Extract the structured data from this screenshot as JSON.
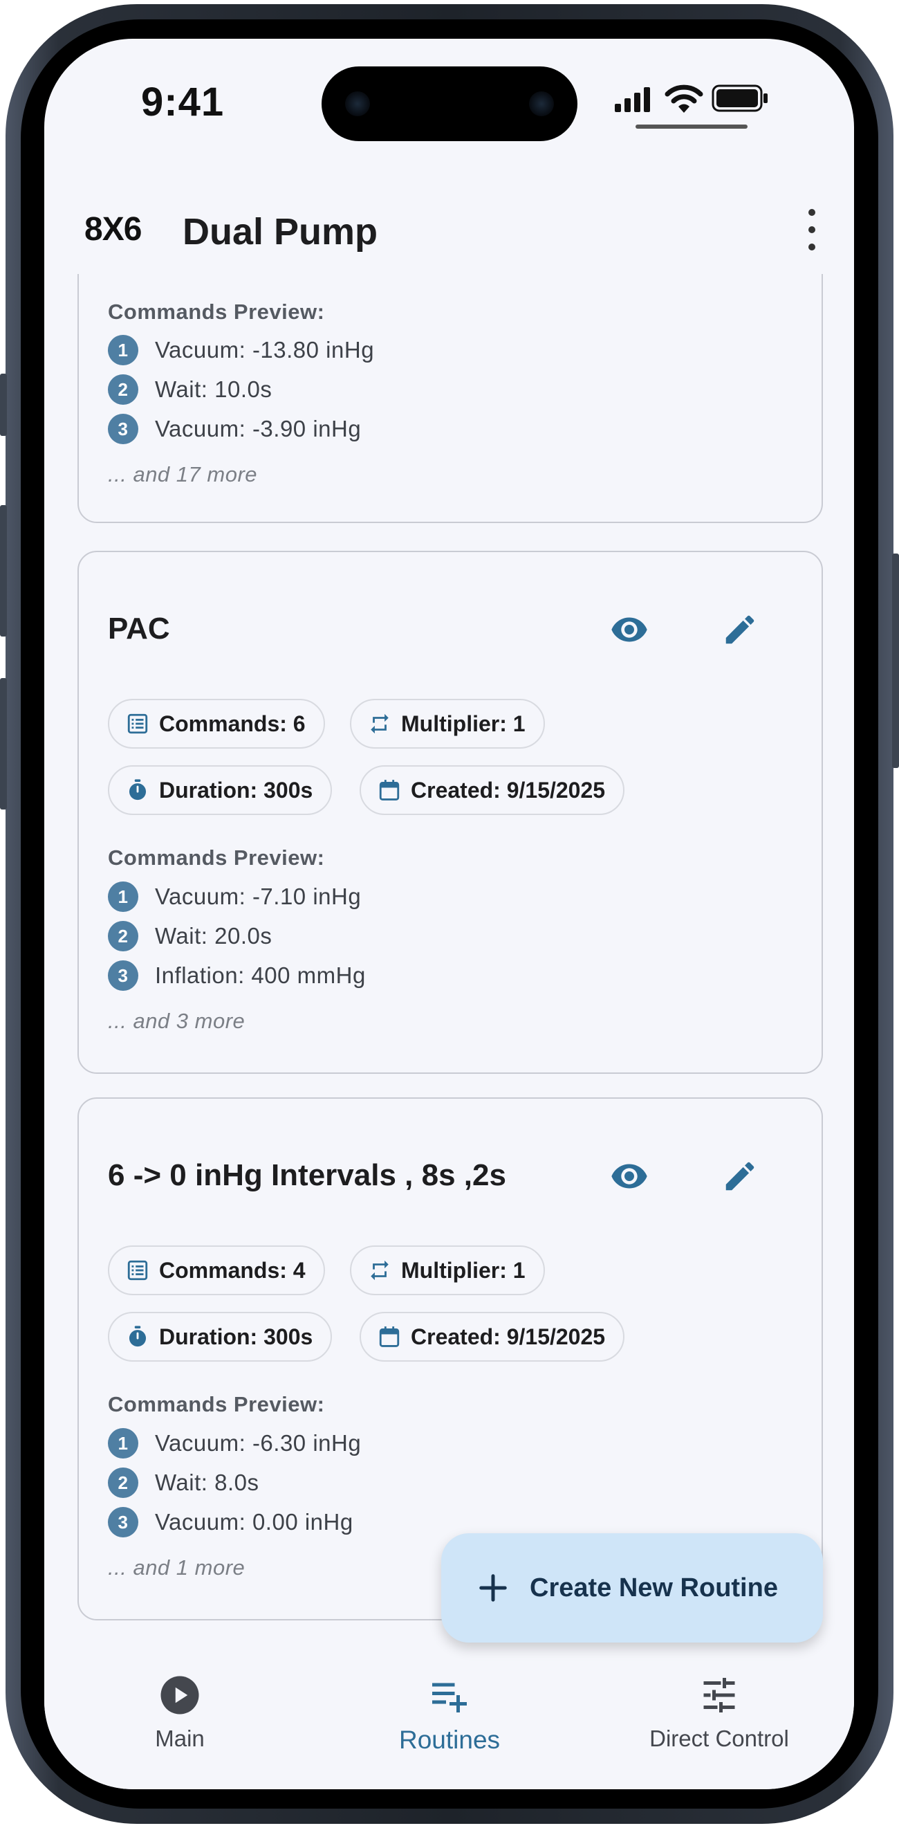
{
  "status_bar": {
    "time": "9:41"
  },
  "app_bar": {
    "logo": "8X6",
    "title": "Dual Pump"
  },
  "routines": [
    {
      "title": "",
      "stats": {},
      "preview_label": "Commands Preview:",
      "commands": [
        "Vacuum: -13.80 inHg",
        "Wait: 10.0s",
        "Vacuum: -3.90 inHg"
      ],
      "more": "... and 17 more"
    },
    {
      "title": "PAC",
      "stats": {
        "commands": "Commands: 6",
        "multiplier": "Multiplier: 1",
        "duration": "Duration: 300s",
        "created": "Created: 9/15/2025"
      },
      "preview_label": "Commands Preview:",
      "commands": [
        "Vacuum: -7.10 inHg",
        "Wait: 20.0s",
        "Inflation: 400 mmHg"
      ],
      "more": "... and 3 more"
    },
    {
      "title": "6 -> 0 inHg Intervals , 8s ,2s",
      "stats": {
        "commands": "Commands: 4",
        "multiplier": "Multiplier: 1",
        "duration": "Duration: 300s",
        "created": "Created: 9/15/2025"
      },
      "preview_label": "Commands Preview:",
      "commands": [
        "Vacuum: -6.30 inHg",
        "Wait: 8.0s",
        "Vacuum: 0.00 inHg"
      ],
      "more": "... and 1 more"
    }
  ],
  "fab": {
    "label": "Create New Routine",
    "icon": "plus-icon"
  },
  "bottom_nav": {
    "items": [
      {
        "label": "Main",
        "icon": "play-circle-icon"
      },
      {
        "label": "Routines",
        "icon": "playlist-add-icon",
        "active": true
      },
      {
        "label": "Direct Control",
        "icon": "sliders-icon"
      }
    ]
  },
  "colors": {
    "accent": "#2d6d97",
    "step_badge": "#4f7fa3",
    "fab_bg": "#cfe5f8",
    "background": "#f5f6fb"
  }
}
